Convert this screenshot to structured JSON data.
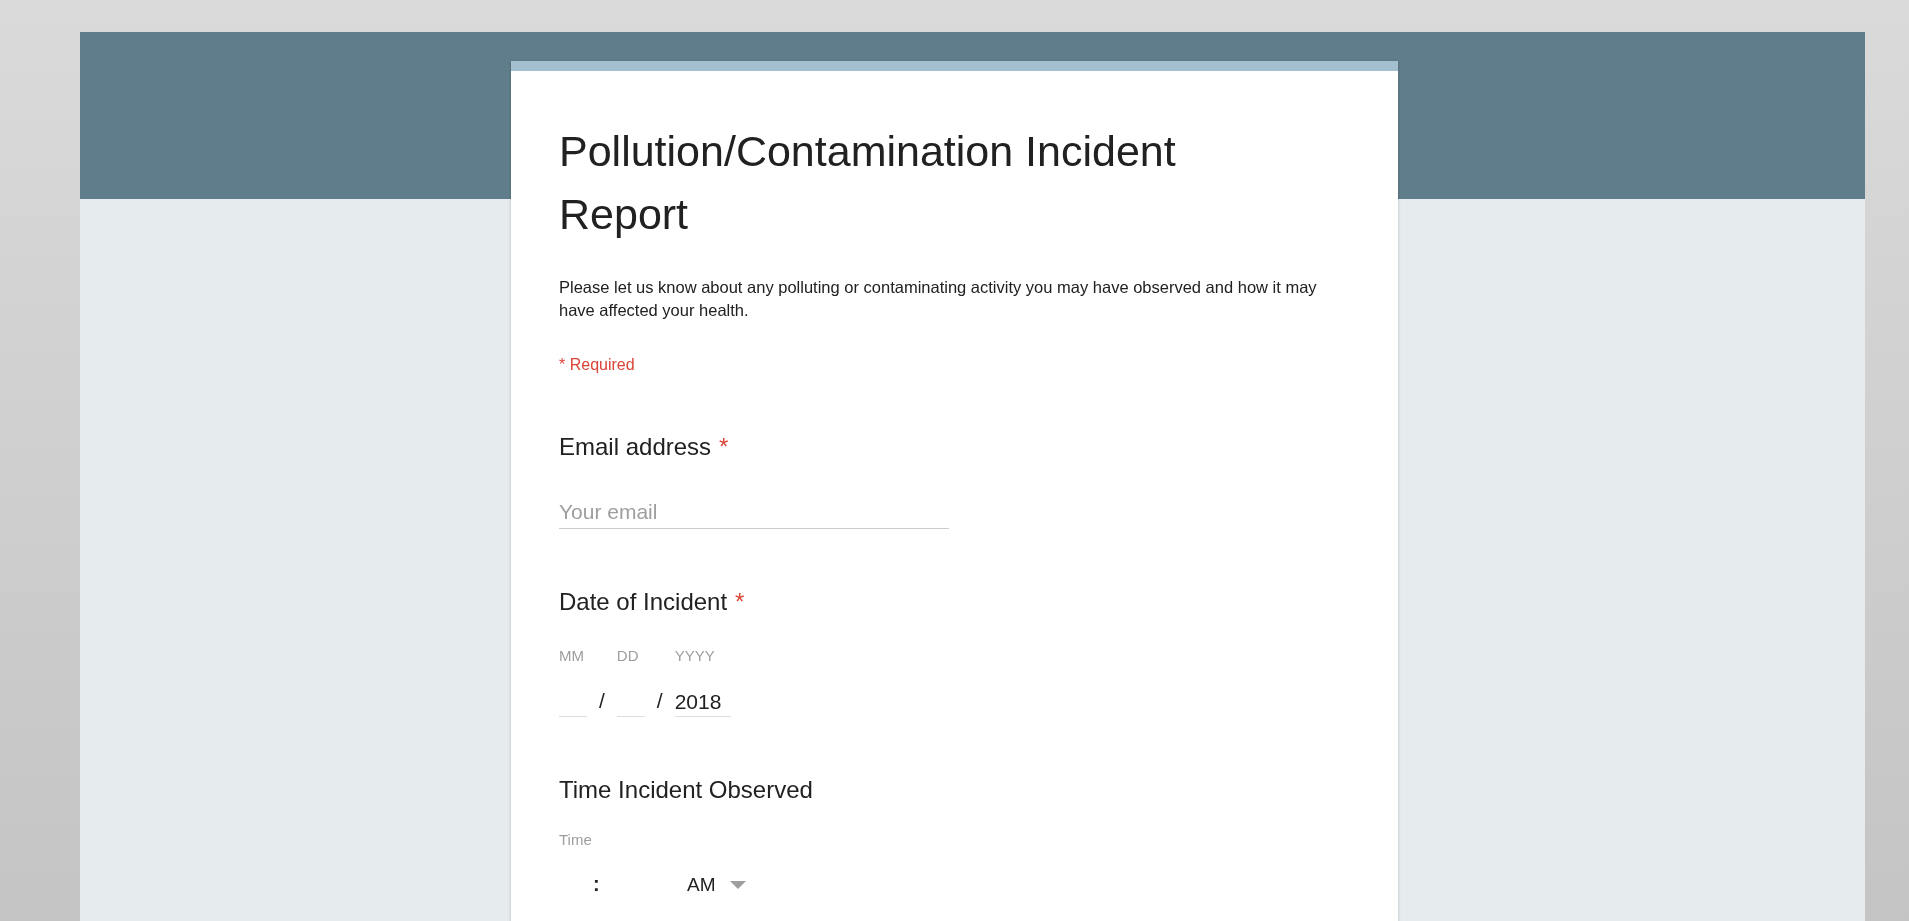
{
  "form": {
    "title": "Pollution/Contamination Incident Report",
    "description": "Please let us know about any polluting or contaminating activity you may have observed and how it may have affected your health.",
    "required_note": "* Required",
    "required_mark": "*",
    "questions": [
      {
        "kind": "text",
        "title": "Email address",
        "required": true,
        "placeholder": "Your email"
      },
      {
        "kind": "date",
        "title": "Date of Incident",
        "required": true,
        "parts": [
          {
            "label": "MM",
            "separator": "/"
          },
          {
            "label": "DD",
            "separator": "/"
          },
          {
            "label": "YYYY",
            "value": "2018"
          }
        ]
      },
      {
        "kind": "time",
        "title": "Time Incident Observed",
        "required": false,
        "label": "Time",
        "separator": ":",
        "period": "AM"
      }
    ]
  }
}
